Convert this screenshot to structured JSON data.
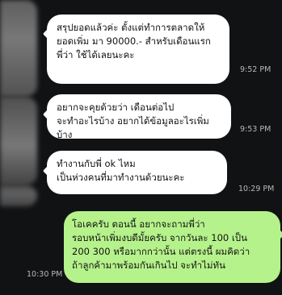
{
  "messages": [
    {
      "direction": "incoming",
      "text": "สรุปยอดแล้วค่ะ   ตั้งแต่ทำการตลาดให้\nยอดเพิ่ม มา 90000.- สำหรับเดือนแรก\nพี่ว่า ใช้ได้เลยนะคะ",
      "time": "9:52 PM"
    },
    {
      "direction": "incoming",
      "text": "อยากจะคุยด้วยว่า  เดือนต่อไป\nจะทำอะไรบ้าง  อยากได้ข้อมูลอะไรเพิ่มบ้าง",
      "time": "9:53 PM"
    },
    {
      "direction": "incoming",
      "text": "ทำงานกับพี่ ok ไหม\nเป็นห่วงคนที่มาทำงานด้วยนะคะ",
      "time": "10:29 PM"
    },
    {
      "direction": "outgoing",
      "text": "โอเคครับ ตอนนี้ อยากจะถามพี่ว่า\nรอบหน้าเพิ่มงบดีมั้ยครับ จากวันละ 100 เป็น\n200 300 หรือมากกว่านั้น แต่ตรงนี้ ผมคิดว่า\nถ้าลูกค้ามาพร้อมกันเกินไป จะทำไม่ทัน",
      "time": "10:30 PM"
    }
  ],
  "colors": {
    "background": "#111214",
    "incoming_bubble": "#ffffff",
    "outgoing_bubble": "#b6f28b",
    "timestamp": "#b9b9b9"
  }
}
